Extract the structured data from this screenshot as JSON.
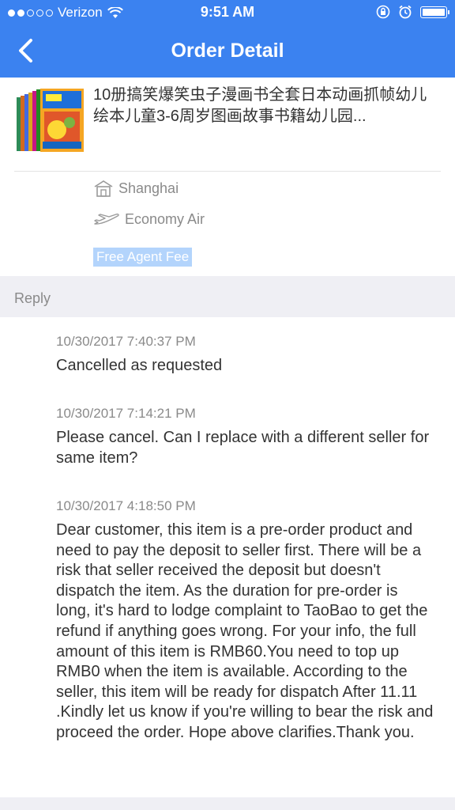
{
  "status_bar": {
    "carrier": "Verizon",
    "time": "9:51 AM",
    "signal_icon": "signal-dots-icon",
    "wifi_icon": "wifi-icon",
    "lock_icon": "rotation-lock-icon",
    "alarm_icon": "alarm-icon",
    "battery_icon": "battery-icon"
  },
  "nav": {
    "title": "Order Detail",
    "back_icon": "chevron-left-icon"
  },
  "product": {
    "title": "10册搞笑爆笑虫子漫画书全套日本动画抓帧幼儿绘本儿童3-6周岁图画故事书籍幼儿园...",
    "city": "Shanghai",
    "shipping": "Economy Air",
    "fee_tag": "Free Agent Fee",
    "city_icon": "warehouse-icon",
    "shipping_icon": "airplane-icon"
  },
  "reply": {
    "header": "Reply",
    "messages": [
      {
        "time": "10/30/2017 7:40:37 PM",
        "body": "Cancelled as requested"
      },
      {
        "time": "10/30/2017 7:14:21 PM",
        "body": "Please cancel. Can I replace with a different seller for same item?"
      },
      {
        "time": "10/30/2017 4:18:50 PM",
        "body": "Dear customer, this item is a pre-order product and need to pay the deposit to seller first. There will be a risk that seller received the deposit but doesn't dispatch the item. As the duration for pre-order is long, it's hard to lodge complaint to TaoBao to get the refund if anything goes wrong. For your info, the full amount of this item is RMB60.You need to top up RMB0 when the item is available. According to the seller, this item will be ready for dispatch After 11.11 .Kindly let us know if you're willing to bear the risk and proceed the order. Hope above clarifies.Thank you."
      }
    ]
  },
  "colors": {
    "nav_bg": "#3b82f0",
    "section_bg": "#efeff4",
    "fee_tag_bg": "#b3d4fc"
  }
}
